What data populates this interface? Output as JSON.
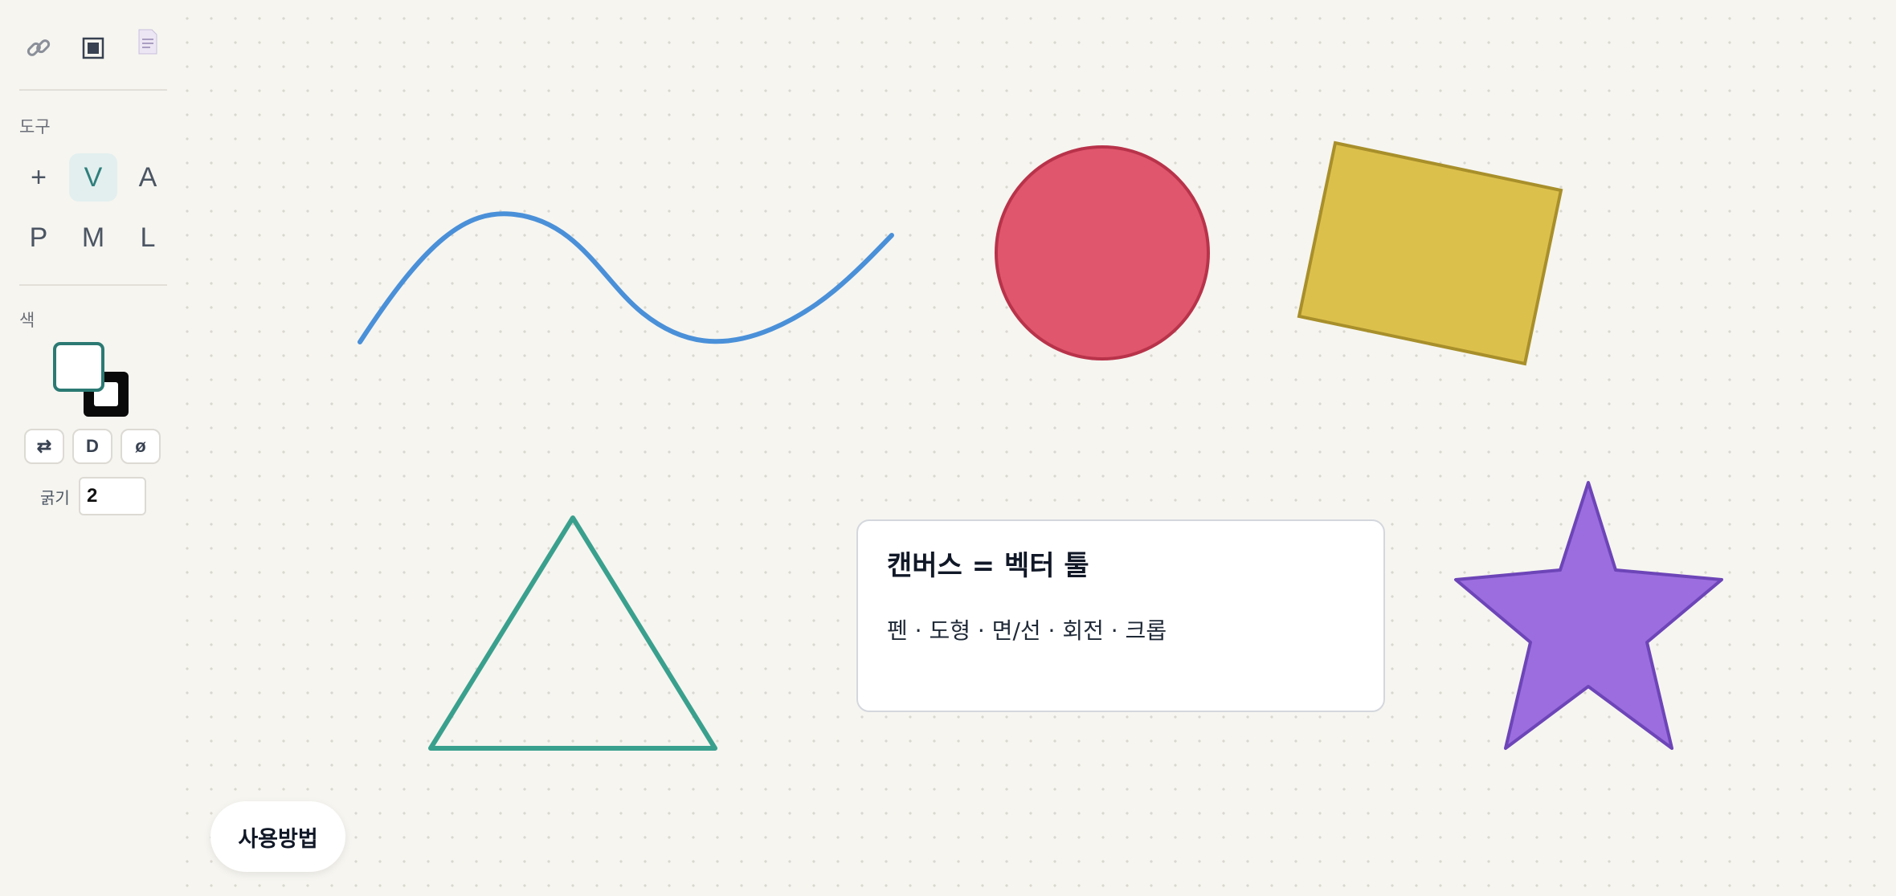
{
  "sidebar": {
    "top_icons": [
      {
        "icon": "link-icon"
      },
      {
        "icon": "frame-icon"
      },
      {
        "icon": "document-icon"
      }
    ],
    "tools_label": "도구",
    "tools": [
      {
        "label": "+",
        "active": false
      },
      {
        "label": "V",
        "active": true
      },
      {
        "label": "A",
        "active": false
      },
      {
        "label": "P",
        "active": false
      },
      {
        "label": "M",
        "active": false
      },
      {
        "label": "L",
        "active": false
      }
    ],
    "color_label": "색",
    "colors": {
      "fill": "#ffffff",
      "fill_border": "#2b7a73",
      "stroke": "#0a0a0a"
    },
    "color_buttons": {
      "swap": "⇄",
      "default": "D",
      "none": "ø"
    },
    "thickness_label": "굵기",
    "thickness_value": "2"
  },
  "canvas": {
    "shapes": [
      {
        "type": "curve",
        "stroke": "#4a90d9"
      },
      {
        "type": "circle",
        "fill": "#e0566c",
        "stroke": "#b8334a"
      },
      {
        "type": "rectangle",
        "fill": "#dcc04c",
        "stroke": "#a88f2a"
      },
      {
        "type": "triangle",
        "fill": "none",
        "stroke": "#3aa08e"
      },
      {
        "type": "star",
        "fill": "#9b6dde",
        "stroke": "#6d45b8"
      }
    ],
    "note": {
      "title": "캔버스 = 벡터 툴",
      "body": "펜 · 도형 · 면/선 · 회전 · 크롭"
    }
  },
  "help_button": "사용방법"
}
